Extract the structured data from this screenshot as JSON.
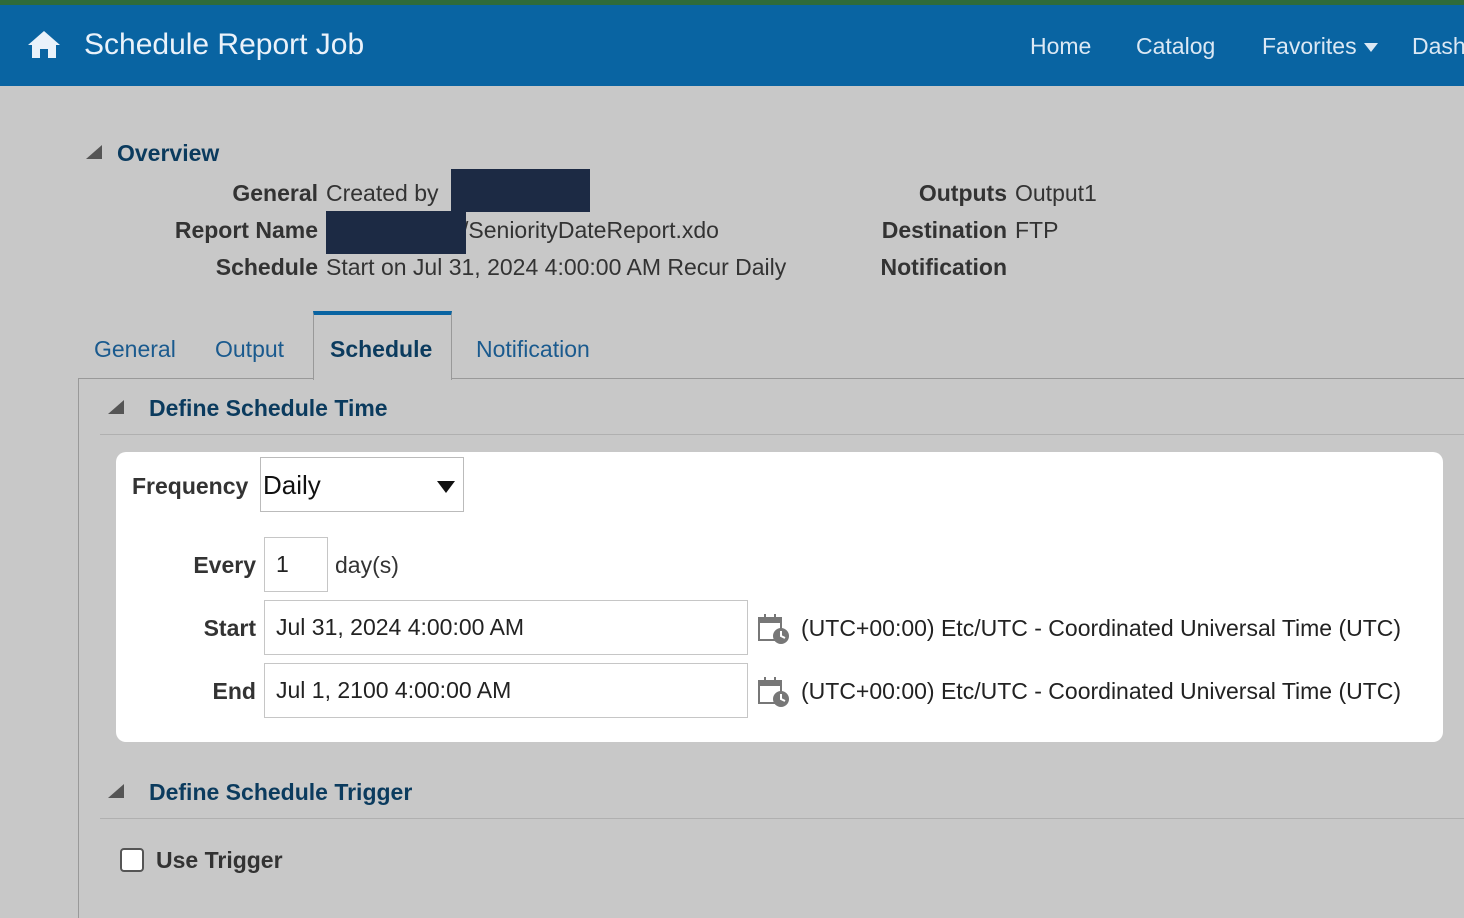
{
  "header": {
    "title": "Schedule Report Job",
    "nav": [
      "Home",
      "Catalog",
      "Favorites",
      "Dash"
    ]
  },
  "overview": {
    "title": "Overview",
    "general_label": "General",
    "general_value": "Created by",
    "report_name_label": "Report Name",
    "report_name_value": "/SeniorityDateReport.xdo",
    "schedule_label": "Schedule",
    "schedule_value": "Start on Jul 31, 2024 4:00:00 AM Recur Daily",
    "outputs_label": "Outputs",
    "outputs_value": "Output1",
    "destination_label": "Destination",
    "destination_value": "FTP",
    "notification_label": "Notification"
  },
  "tabs": [
    "General",
    "Output",
    "Schedule",
    "Notification"
  ],
  "active_tab": "Schedule",
  "schedule_time": {
    "title": "Define Schedule Time",
    "frequency_label": "Frequency",
    "frequency_value": "Daily",
    "every_label": "Every",
    "every_value": "1",
    "every_unit": "day(s)",
    "start_label": "Start",
    "start_value": "Jul 31, 2024 4:00:00 AM",
    "end_label": "End",
    "end_value": "Jul 1, 2100 4:00:00 AM",
    "timezone": "(UTC+00:00) Etc/UTC - Coordinated Universal Time (UTC)"
  },
  "schedule_trigger": {
    "title": "Define Schedule Trigger",
    "use_trigger_label": "Use Trigger",
    "use_trigger_checked": false
  },
  "colors": {
    "header_bg": "#0964a2",
    "page_bg": "#c8c8c8",
    "section_title": "#0b3b5e",
    "tab_link": "#1a5a8e",
    "redaction": "#1c2a44"
  }
}
